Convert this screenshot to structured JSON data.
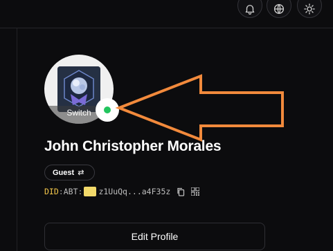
{
  "header": {
    "icons": [
      "bell-icon",
      "globe-icon",
      "sun-icon"
    ]
  },
  "profile": {
    "avatar_action": "Switch",
    "status_color": "#22c55e",
    "name": "John Christopher Morales",
    "role": "Guest",
    "role_swap_glyph": "⇄",
    "did": {
      "prefix": "DID",
      "type": "ABT",
      "address": "z1UuQq...a4F35z"
    },
    "edit_button": "Edit Profile"
  },
  "annotation": {
    "arrow_color": "#f28a3c"
  }
}
